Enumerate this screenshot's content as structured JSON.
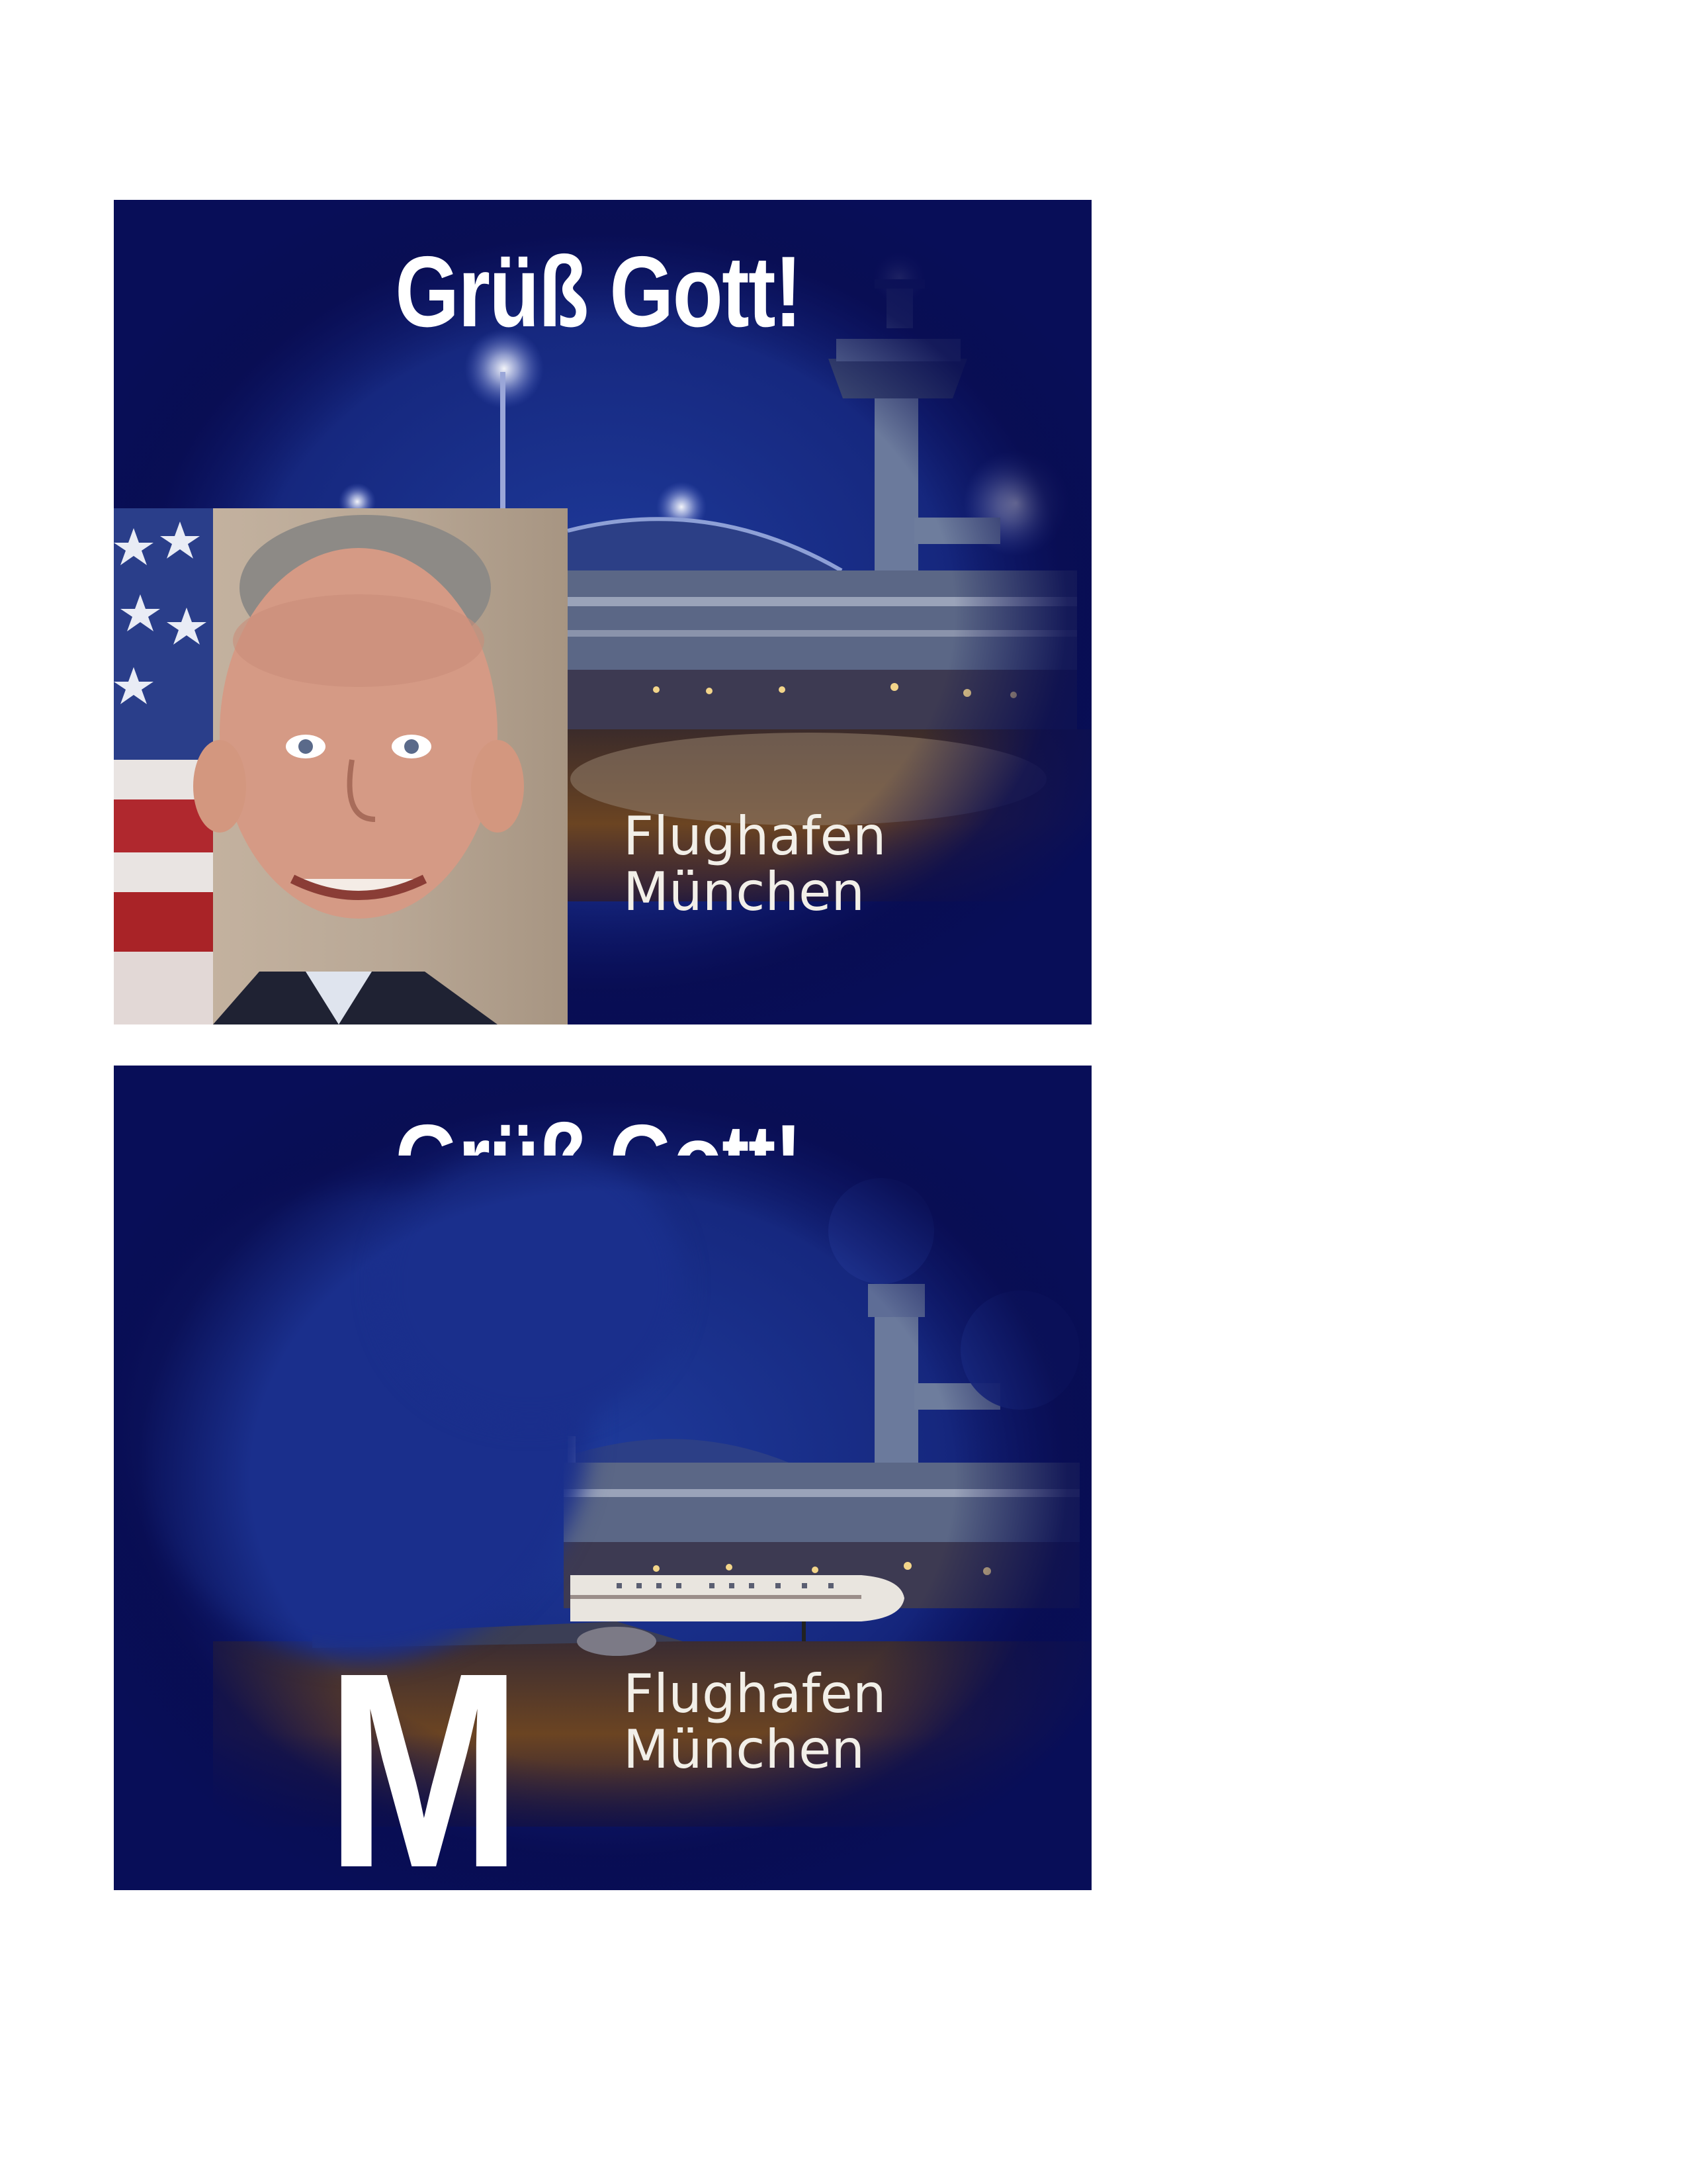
{
  "page": {
    "background": "#ffffff"
  },
  "panels": [
    {
      "headline": "Grüß Gott!",
      "caption_line1": "Flughafen",
      "caption_line2": "München",
      "inset_photo": "portrait-photo"
    },
    {
      "headline": "Grüß Gott!",
      "caption_line1": "Flughafen",
      "caption_line2": "München",
      "logo_letter": "M"
    }
  ],
  "colors": {
    "night_blue": "#0c1466",
    "mid_blue": "#1e3a9a",
    "text_white": "#ffffff",
    "ground_brown": "#6b4422"
  }
}
